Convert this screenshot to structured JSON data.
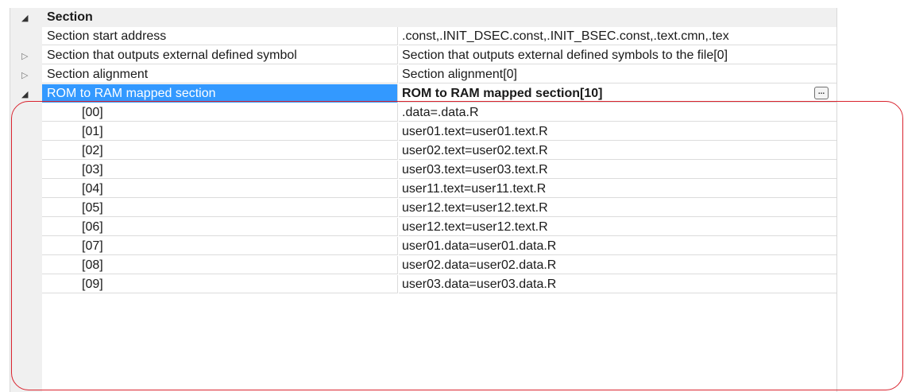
{
  "category": {
    "title": "Section",
    "expanded": true
  },
  "rows": {
    "start_address": {
      "label": "Section start address",
      "value": ".const,.INIT_DSEC.const,.INIT_BSEC.const,.text.cmn,.tex"
    },
    "external_symbol": {
      "label": "Section that outputs external defined symbol",
      "value": "Section that outputs external defined symbols to the file[0]"
    },
    "alignment": {
      "label": "Section alignment",
      "value": "Section alignment[0]"
    },
    "rom_to_ram": {
      "label": "ROM to RAM mapped section",
      "value": "ROM to RAM mapped section[10]",
      "button": "..."
    }
  },
  "children": [
    {
      "index": "[00]",
      "value": ".data=.data.R"
    },
    {
      "index": "[01]",
      "value": "user01.text=user01.text.R"
    },
    {
      "index": "[02]",
      "value": "user02.text=user02.text.R"
    },
    {
      "index": "[03]",
      "value": "user03.text=user03.text.R"
    },
    {
      "index": "[04]",
      "value": "user11.text=user11.text.R"
    },
    {
      "index": "[05]",
      "value": "user12.text=user12.text.R"
    },
    {
      "index": "[06]",
      "value": "user12.text=user12.text.R"
    },
    {
      "index": "[07]",
      "value": "user01.data=user01.data.R"
    },
    {
      "index": "[08]",
      "value": "user02.data=user02.data.R"
    },
    {
      "index": "[09]",
      "value": "user03.data=user03.data.R"
    }
  ],
  "colors": {
    "selection": "#3399ff",
    "highlight": "#d9232e",
    "gutter": "#f0f0f0"
  }
}
